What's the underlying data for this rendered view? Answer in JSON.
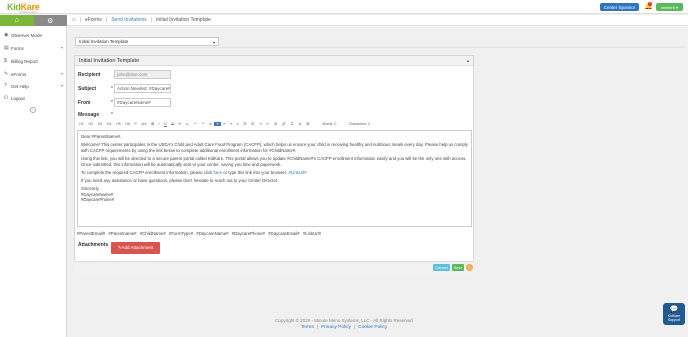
{
  "header": {
    "brand_part1": "Kid",
    "brand_part2": "Kare",
    "tagline": "by Minute Menu",
    "sponsor_button": "Center Sponsor",
    "notification_count": "1",
    "user_button": "sheilerb ▾"
  },
  "breadcrumb": {
    "home_icon": "home-icon",
    "items": [
      "eForms",
      "Send Invitations",
      "Initial Invitation Template"
    ]
  },
  "sidebar": {
    "items": [
      {
        "label": "Observer Mode",
        "icon": "eye-icon"
      },
      {
        "label": "Forms",
        "icon": "forms-icon",
        "chevron": "▾"
      },
      {
        "label": "Billing Report",
        "icon": "dollar-icon"
      },
      {
        "label": "eForms",
        "icon": "eforms-icon",
        "chevron": "▾"
      },
      {
        "label": "Get Help",
        "icon": "help-icon",
        "chevron": "▾"
      },
      {
        "label": "Logout",
        "icon": "logout-icon"
      }
    ]
  },
  "template_select": {
    "value": "Initial Invitation Template"
  },
  "panel": {
    "title": "Initial Invitation Template",
    "recipient_label": "Recipient",
    "recipient_value": "john@doe.com",
    "subject_label": "Subject",
    "subject_value": "Action Needed: #DaycareName#",
    "from_label": "From",
    "from_value": "#DaycareName#",
    "message_label": "Message",
    "toolbar": [
      "H1",
      "H2",
      "H3",
      "H4",
      "H5",
      "H6",
      "P",
      "pre",
      "B",
      "I",
      "U",
      "S",
      "x²",
      "x₂",
      "↶",
      "↷",
      "⊘",
      "≡",
      "≡",
      "≡",
      "≡",
      "☰",
      "☰",
      "⇥",
      "⇤",
      "⊞",
      "🔗",
      "⊏",
      "⊘",
      "⌘",
      "Words: 0",
      "Characters: 0"
    ],
    "toolbar_active_index": 17,
    "editor": {
      "greeting": "Dear #ParentName#,",
      "p1": "Welcome! This center participates in the USDA's Child and Adult Care Food Program (CACFP), which helps us ensure your child is receiving healthy and nutritious meals every day. Please help us comply with CACFP requirements by using the link below to complete additional enrollment information for #ChildName#.",
      "p2": "Using this link, you will be directed to a secure parent portal called KidKare. This portal allows you to update #ChildName#'s CACFP enrollment information easily and you will be the only one with access. Once submitted, this information will be automatically sent to your center, saving you time and paperwork.",
      "p3_before": "To complete the required CACFP enrollment information, please click ",
      "p3_link1": "here",
      "p3_mid": " or type this link into your browser: ",
      "p3_link2": "#LinkUrl#",
      "p4": "If you need any assistance or have questions, please don't hesitate to reach out to your Center Director.",
      "closing": "Sincerely,",
      "sig1": "#DaycareName#",
      "sig2": "#DaycarePhone#"
    },
    "tags": "#ParentEmail# #Parentname# #ChildName# #FormType# #DaycareName# #DaycarePhone# #DaycareEmail# #LinkUrl#",
    "attachments_label": "Attachments",
    "add_attachment": "✎Add Attachment",
    "cancel": "Cancel",
    "save": "Save",
    "help": "?"
  },
  "footer": {
    "copyright": "Copyright © 2020 - Minute Menu Systems, LLC - All Rights Reserved",
    "terms": "Terms",
    "privacy": "Privacy Policy",
    "cookie": "Cookie Policy"
  },
  "support": {
    "label": "KidKare Support"
  },
  "colors": {
    "brand_green": "#7bb63a",
    "brand_orange": "#f29100",
    "primary_blue": "#2e74c0",
    "danger_red": "#d9534f"
  }
}
